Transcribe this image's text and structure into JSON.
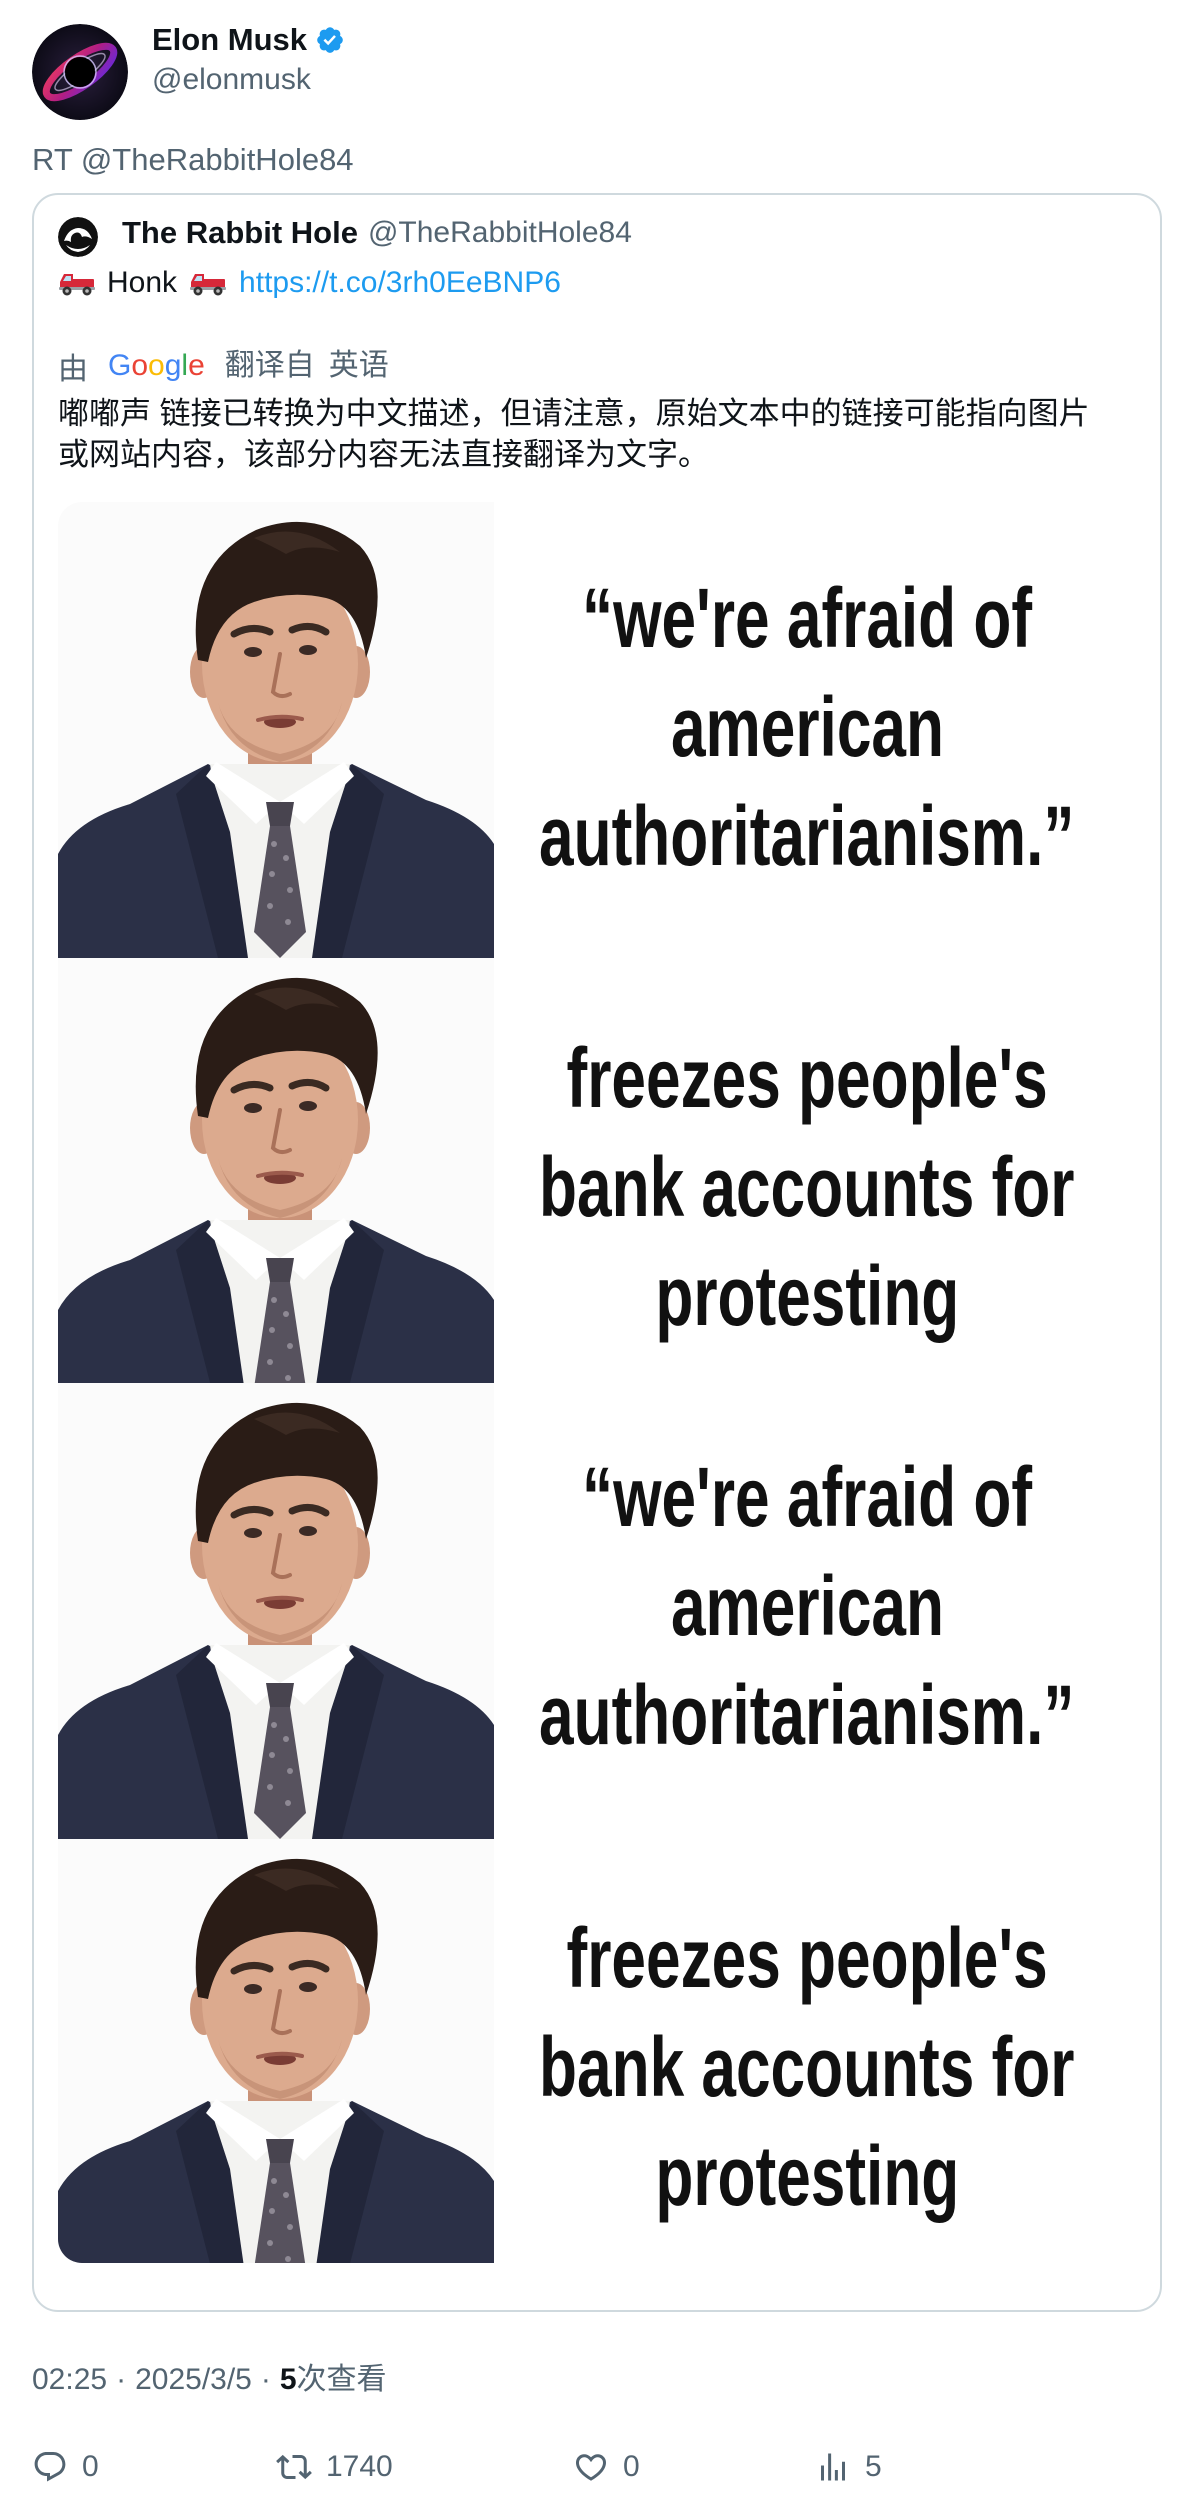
{
  "colors": {
    "accent": "#1d9bf0",
    "text_primary": "#0f1419",
    "text_secondary": "#536471",
    "border": "#cfd9de",
    "verified": "#1d9bf0",
    "caption": "#111111"
  },
  "author": {
    "name": "Elon Musk",
    "handle": "@elonmusk",
    "avatar_icon": "black-hole-avatar",
    "verified_icon": "verified-badge-icon"
  },
  "retweet": {
    "text": "RT @TheRabbitHole84"
  },
  "quoted": {
    "author": {
      "name": "The Rabbit Hole",
      "handle": "@TheRabbitHole84",
      "avatar_icon": "rabbit-hole-avatar"
    },
    "body": {
      "icon": "pickup-truck-icon",
      "word": "Honk",
      "link": "https://t.co/3rh0EeBNP6"
    },
    "translation": {
      "prefix": "由",
      "brand": "Google",
      "brand_colors": [
        "#4285F4",
        "#EA4335",
        "#FBBC05",
        "#4285F4",
        "#34A853",
        "#EA4335"
      ],
      "label": "翻译自",
      "language": "英语",
      "lines": [
        "嘟嘟声 链接已转换为中文描述，但请注意，原始文本中的链接可能指向图片",
        "或网站内容，该部分内容无法直接翻译为文字。"
      ]
    },
    "media": {
      "panels": [
        {
          "caption": [
            "“we're afraid of",
            "american",
            "authoritarianism.”"
          ]
        },
        {
          "caption": [
            "freezes people's",
            "bank accounts for",
            "protesting"
          ]
        },
        {
          "caption": [
            "“we're afraid of",
            "american",
            "authoritarianism.”"
          ]
        },
        {
          "caption": [
            "freezes people's",
            "bank accounts for",
            "protesting"
          ]
        }
      ]
    }
  },
  "meta": {
    "time": "02:25",
    "separator": "·",
    "date": "2025/3/5",
    "views_count": "5",
    "views_label": "次查看"
  },
  "actions": [
    {
      "icon": "reply-icon",
      "count": "0"
    },
    {
      "icon": "retweet-icon",
      "count": "1740"
    },
    {
      "icon": "like-icon",
      "count": "0"
    },
    {
      "icon": "views-icon",
      "count": "5"
    }
  ]
}
